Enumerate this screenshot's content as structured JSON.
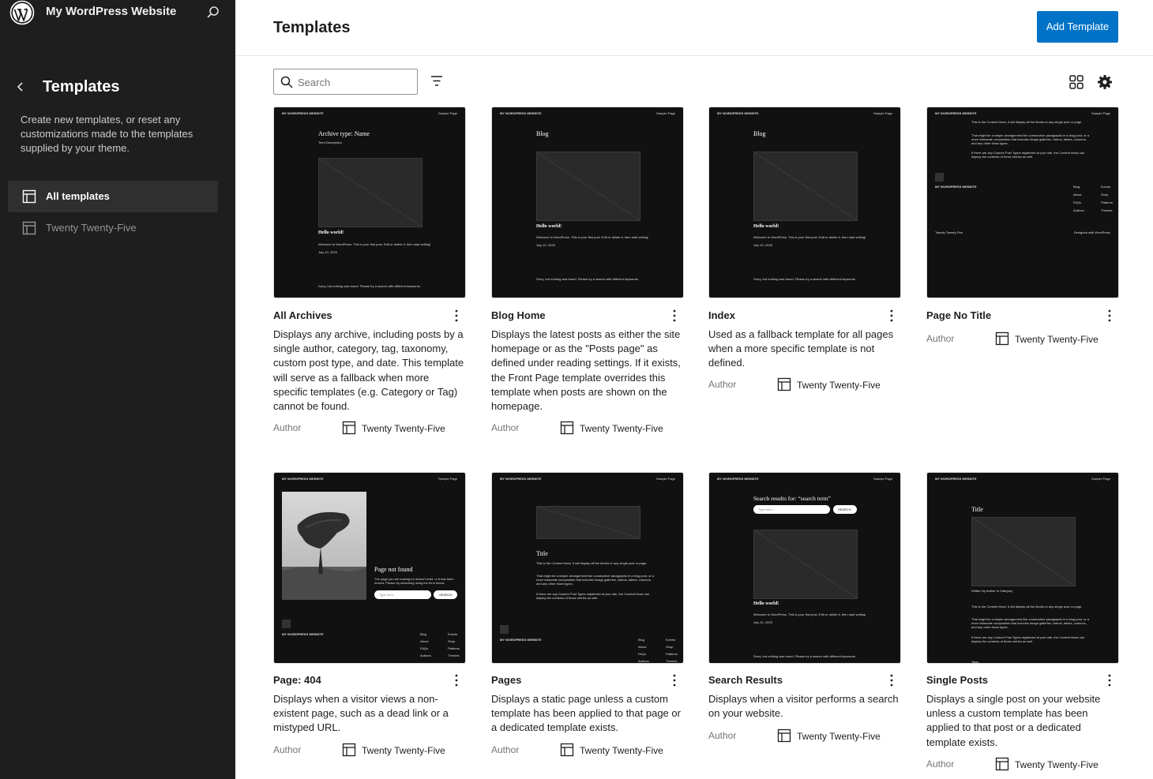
{
  "site": {
    "title": "My WordPress Website"
  },
  "sidebar": {
    "title": "Templates",
    "description": "Create new templates, or reset any customizations made to the templates supplied by your theme.",
    "items": [
      {
        "label": "All templates",
        "active": true
      },
      {
        "label": "Twenty Twenty-Five",
        "active": false
      }
    ]
  },
  "header": {
    "title": "Templates",
    "add_label": "Add Template"
  },
  "search": {
    "placeholder": "Search"
  },
  "colors": {
    "accent": "#0073c7",
    "sidebar_bg": "#1e1e1e",
    "thumb_bg": "#111111"
  },
  "templates": [
    {
      "title": "All Archives",
      "description": "Displays any archive, including posts by a single author, category, tag, taxonomy, custom post type, and date. This template will serve as a fallback when more specific templates (e.g. Category or Tag) cannot be found.",
      "author": "Author",
      "theme": "Twenty Twenty-Five",
      "preview": {
        "site": "MY WORDPRESS WEBSITE",
        "nav": "Sample Page",
        "heading": "Archive type: Name",
        "sub": "Term Description",
        "post": "Hello world!",
        "post_text": "Welcome to WordPress. This is your first post. Edit or delete it, then start writing!",
        "date": "July 10, 2025",
        "footer": "Sorry, but nothing was found. Please try a search with different keywords."
      }
    },
    {
      "title": "Blog Home",
      "description": "Displays the latest posts as either the site homepage or as the \"Posts page\" as defined under reading settings. If it exists, the Front Page template overrides this template when posts are shown on the homepage.",
      "author": "Author",
      "theme": "Twenty Twenty-Five",
      "preview": {
        "site": "MY WORDPRESS WEBSITE",
        "nav": "Sample Page",
        "heading": "Blog",
        "post": "Hello world!",
        "post_text": "Welcome to WordPress. This is your first post. Edit or delete it, then start writing!",
        "date": "July 10, 2025",
        "footer": "Sorry, but nothing was found. Please try a search with different keywords."
      }
    },
    {
      "title": "Index",
      "description": "Used as a fallback template for all pages when a more specific template is not defined.",
      "author": "Author",
      "theme": "Twenty Twenty-Five",
      "preview": {
        "site": "MY WORDPRESS WEBSITE",
        "nav": "Sample Page",
        "heading": "Blog",
        "post": "Hello world!",
        "post_text": "Welcome to WordPress. This is your first post. Edit or delete it, then start writing!",
        "date": "July 10, 2025",
        "footer": "Sorry, but nothing was found. Please try a search with different keywords."
      }
    },
    {
      "title": "Page No Title",
      "description": "",
      "author": "Author",
      "theme": "Twenty Twenty-Five",
      "preview": {
        "site": "MY WORDPRESS WEBSITE",
        "nav": "Sample Page",
        "p1": "This is the Content block, it will display all the blocks in any single post or page.",
        "p2": "That might be a simple arrangement like consecutive paragraphs in a blog post, or a more elaborate composition that includes image galleries, videos, tables, columns, and any other block types.",
        "p3": "If there are any Custom Post Types registered at your site, the Content block can display the contents of those entries as well.",
        "footer_site": "MY WORDPRESS WEBSITE",
        "links": [
          "Blog",
          "About",
          "FAQs",
          "Authors"
        ],
        "links2": [
          "Events",
          "Shop",
          "Patterns",
          "Themes"
        ],
        "footer_left": "Twenty Twenty-Five",
        "footer_right": "Designed with WordPress"
      }
    },
    {
      "title": "Page: 404",
      "description": "Displays when a visitor views a non-existent page, such as a dead link or a mistyped URL.",
      "author": "Author",
      "theme": "Twenty Twenty-Five",
      "preview": {
        "site": "MY WORDPRESS WEBSITE",
        "nav": "Sample Page",
        "heading": "Page not found",
        "text": "The page you are looking for doesn't exist, or it has been moved. Please try searching using the form below.",
        "search_ph": "Type here...",
        "search_btn": "SEARCH",
        "footer_site": "MY WORDPRESS WEBSITE",
        "links": [
          "Blog",
          "About",
          "FAQs",
          "Authors"
        ],
        "links2": [
          "Events",
          "Shop",
          "Patterns",
          "Themes"
        ]
      }
    },
    {
      "title": "Pages",
      "description": "Displays a static page unless a custom template has been applied to that page or a dedicated template exists.",
      "author": "Author",
      "theme": "Twenty Twenty-Five",
      "preview": {
        "site": "MY WORDPRESS WEBSITE",
        "nav": "Sample Page",
        "heading": "Title",
        "p1": "This is the Content block, it will display all the blocks in any single post or page.",
        "p2": "That might be a simple arrangement like consecutive paragraphs in a blog post, or a more elaborate composition that includes image galleries, videos, tables, columns, and any other block types.",
        "p3": "If there are any Custom Post Types registered at your site, the Content block can display the contents of those entries as well.",
        "footer_site": "MY WORDPRESS WEBSITE",
        "links": [
          "Blog",
          "About",
          "FAQs",
          "Authors"
        ],
        "links2": [
          "Events",
          "Shop",
          "Patterns",
          "Themes"
        ]
      }
    },
    {
      "title": "Search Results",
      "description": "Displays when a visitor performs a search on your website.",
      "author": "Author",
      "theme": "Twenty Twenty-Five",
      "preview": {
        "site": "MY WORDPRESS WEBSITE",
        "nav": "Sample Page",
        "heading": "Search results for: “search term”",
        "search_ph": "Type here...",
        "search_btn": "SEARCH",
        "post": "Hello world!",
        "post_text": "Welcome to WordPress. This is your first post. Edit or delete it, then start writing!",
        "date": "July 10, 2025",
        "footer": "Sorry, but nothing was found. Please try a search with different keywords."
      }
    },
    {
      "title": "Single Posts",
      "description": "Displays a single post on your website unless a custom template has been applied to that post or a dedicated template exists.",
      "author": "Author",
      "theme": "Twenty Twenty-Five",
      "preview": {
        "site": "MY WORDPRESS WEBSITE",
        "nav": "Sample Page",
        "heading": "Title",
        "meta": "Written by Author in Category",
        "p1": "This is the Content block, it will display all the blocks in any single post or page.",
        "p2": "That might be a simple arrangement like consecutive paragraphs in a blog post, or a more elaborate composition that includes image galleries, videos, tables, columns, and any other block types.",
        "p3": "If there are any Custom Post Types registered at your site, the Content block can display the contents of those entries as well.",
        "tags": "Tags:"
      }
    }
  ]
}
